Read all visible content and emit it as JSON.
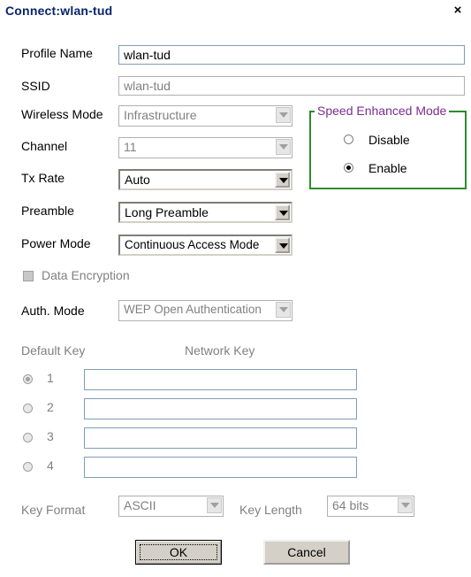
{
  "window": {
    "title": "Connect:wlan-tud",
    "close_symbol": "×"
  },
  "profile": {
    "profile_name_label": "Profile Name",
    "profile_name_value": "wlan-tud",
    "ssid_label": "SSID",
    "ssid_value": "wlan-tud",
    "wireless_mode_label": "Wireless Mode",
    "wireless_mode_value": "Infrastructure",
    "channel_label": "Channel",
    "channel_value": "11",
    "tx_rate_label": "Tx Rate",
    "tx_rate_value": "Auto",
    "preamble_label": "Preamble",
    "preamble_value": "Long Preamble",
    "power_mode_label": "Power Mode",
    "power_mode_value": "Continuous Access Mode"
  },
  "speed_mode": {
    "title": "Speed Enhanced Mode",
    "options": [
      {
        "label": "Disable",
        "selected": false
      },
      {
        "label": "Enable",
        "selected": true
      }
    ]
  },
  "security": {
    "data_encryption_label": "Data Encryption",
    "data_encryption_checked": false,
    "auth_mode_label": "Auth. Mode",
    "auth_mode_value": "WEP Open Authentication",
    "default_key_label": "Default Key",
    "network_key_label": "Network Key",
    "keys": [
      {
        "index": "1",
        "value": ""
      },
      {
        "index": "2",
        "value": ""
      },
      {
        "index": "3",
        "value": ""
      },
      {
        "index": "4",
        "value": ""
      }
    ],
    "key_format_label": "Key Format",
    "key_format_value": "ASCII",
    "key_length_label": "Key Length",
    "key_length_value": "64 bits"
  },
  "buttons": {
    "ok": "OK",
    "cancel": "Cancel"
  },
  "colors": {
    "group_border": "#2e8b2e",
    "group_title": "#7a2e8e",
    "title_text": "#0a246a"
  }
}
